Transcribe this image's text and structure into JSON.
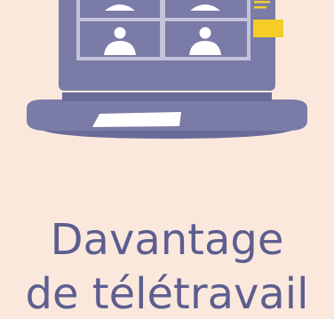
{
  "illustration": {
    "subject": "laptop-video-conference",
    "participants": 4,
    "colors": {
      "background": "#fbe8dd",
      "laptop": "#7a7ba6",
      "laptop_dark": "#6a6b98",
      "screen": "#c3c3dc",
      "avatar": "#ffffff",
      "accent_yellow": "#f5cc28",
      "trackpad": "#ffffff"
    }
  },
  "headline": {
    "line1": "Davantage",
    "line2": "de télétravail"
  }
}
